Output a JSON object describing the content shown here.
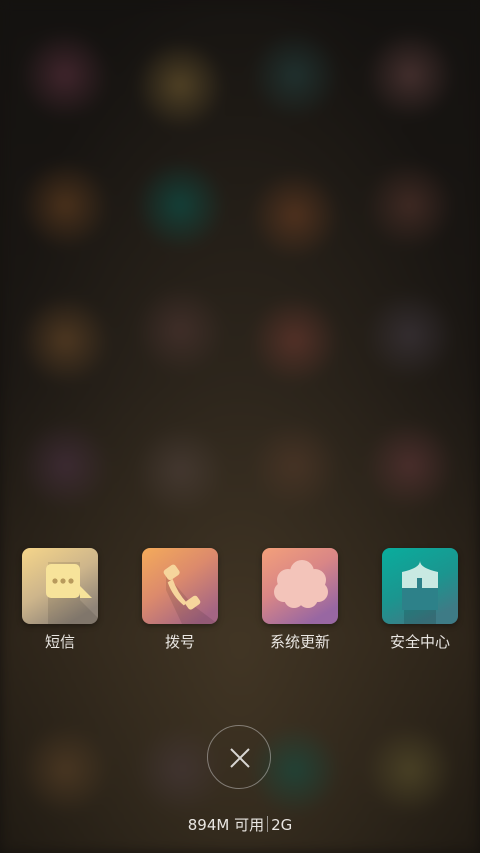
{
  "recent_apps": [
    {
      "label": "短信",
      "icon": "message-bubble-icon",
      "colors": [
        "#f2cf86",
        "#9b8a78"
      ]
    },
    {
      "label": "拨号",
      "icon": "phone-handset-icon",
      "colors": [
        "#f0a45c",
        "#a8667e"
      ]
    },
    {
      "label": "系统更新",
      "icon": "cloud-icon",
      "colors": [
        "#f09a7c",
        "#9a6aa0"
      ]
    },
    {
      "label": "安全中心",
      "icon": "shield-plus-icon",
      "colors": [
        "#0aa89b",
        "#3c7f87"
      ]
    }
  ],
  "close_icon": "close-icon",
  "memory": {
    "available": "894M 可用",
    "total": "2G"
  }
}
